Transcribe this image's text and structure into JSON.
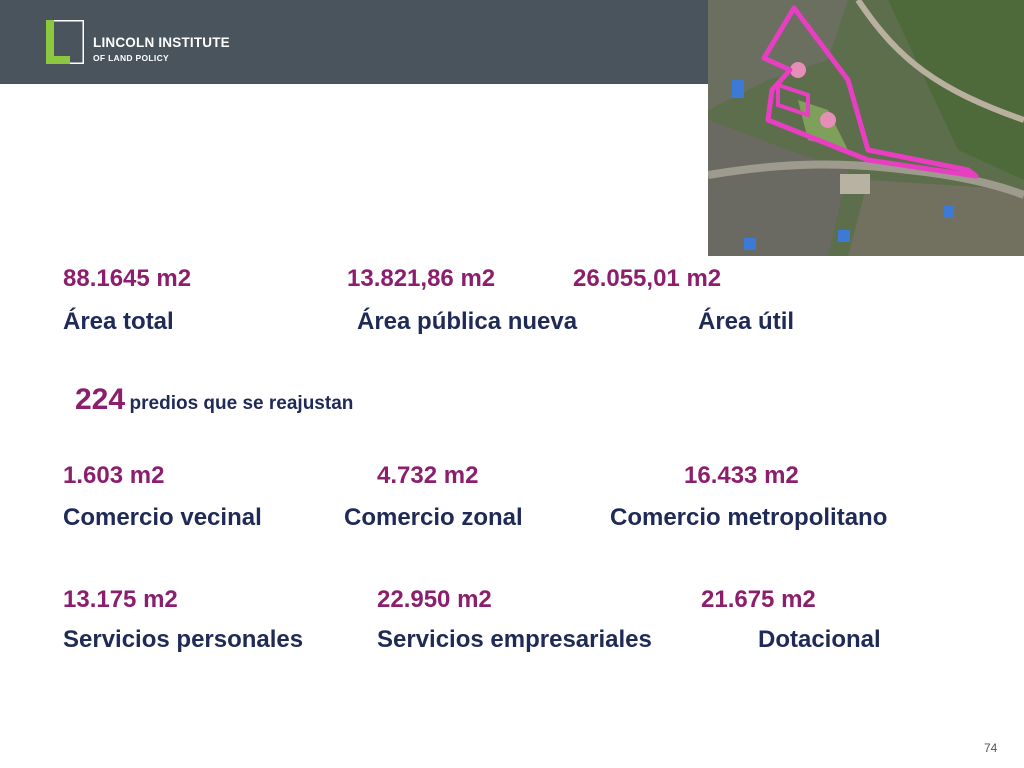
{
  "header": {
    "logo_line1": "LINCOLN INSTITUTE",
    "logo_line2": "OF LAND POLICY",
    "logo_icon": "lincoln-l-mark"
  },
  "aerial_photo": {
    "description_icon": "aerial-map-with-magenta-boundary"
  },
  "row1": {
    "values": [
      "88.1645 m2",
      "13.821,86 m2",
      "26.055,01 m2"
    ],
    "labels": [
      "Área total",
      "Área pública nueva",
      "Área útil"
    ]
  },
  "predios": {
    "count": "224",
    "text": "predios que se reajustan"
  },
  "row2": {
    "values": [
      "1.603 m2",
      "4.732 m2",
      "16.433 m2"
    ],
    "labels": [
      "Comercio vecinal",
      "Comercio zonal",
      "Comercio metropolitano"
    ]
  },
  "row3": {
    "values": [
      "13.175 m2",
      "22.950 m2",
      "21.675 m2"
    ],
    "labels": [
      "Servicios personales",
      "Servicios empresariales",
      "Dotacional"
    ]
  },
  "page_number": "74",
  "colors": {
    "header_bg": "#4a545c",
    "logo_green": "#8dc63f",
    "value_color": "#8c1f6d",
    "label_color": "#1f2a57",
    "boundary": "#e83fc2"
  }
}
